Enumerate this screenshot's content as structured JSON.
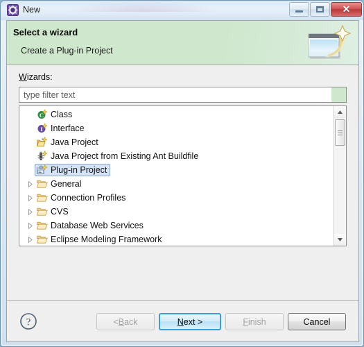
{
  "window": {
    "title": "New",
    "title_icon": "wizard-gear-icon",
    "controls": {
      "minimize": "Minimize",
      "maximize": "Maximize",
      "close": "Close",
      "close_glyph": "✕"
    }
  },
  "header": {
    "title": "Select a wizard",
    "subtitle": "Create a Plug-in Project",
    "art_icon": "new-wizard-sparkle-icon",
    "background_color": "#cfe8cd"
  },
  "body": {
    "wizards_label_prefix": "W",
    "wizards_label_rest": "izards:",
    "filter": {
      "placeholder": "type filter text",
      "value": "",
      "clear_color": "#cfe8cd"
    }
  },
  "tree": {
    "items": [
      {
        "label": "Class",
        "icon": "java-class-icon",
        "expandable": false,
        "selected": false,
        "indent": 0
      },
      {
        "label": "Interface",
        "icon": "java-interface-icon",
        "expandable": false,
        "selected": false,
        "indent": 0
      },
      {
        "label": "Java Project",
        "icon": "java-project-icon",
        "expandable": false,
        "selected": false,
        "indent": 0
      },
      {
        "label": "Java Project from Existing Ant Buildfile",
        "icon": "ant-buildfile-icon",
        "expandable": false,
        "selected": false,
        "indent": 0
      },
      {
        "label": "Plug-in Project",
        "icon": "plugin-project-icon",
        "expandable": false,
        "selected": true,
        "indent": 0
      },
      {
        "label": "General",
        "icon": "folder-icon",
        "expandable": true,
        "selected": false,
        "indent": 0
      },
      {
        "label": "Connection Profiles",
        "icon": "folder-icon",
        "expandable": true,
        "selected": false,
        "indent": 0
      },
      {
        "label": "CVS",
        "icon": "folder-icon",
        "expandable": true,
        "selected": false,
        "indent": 0
      },
      {
        "label": "Database Web Services",
        "icon": "folder-icon",
        "expandable": true,
        "selected": false,
        "indent": 0
      },
      {
        "label": "Eclipse Modeling Framework",
        "icon": "folder-icon",
        "expandable": true,
        "selected": false,
        "indent": 0
      }
    ],
    "scrollbar": {
      "up_arrow": "▲",
      "down_arrow": "▼"
    }
  },
  "footer": {
    "help_icon": "help-question-icon",
    "buttons": {
      "back": {
        "prefix": "< ",
        "accel": "B",
        "rest": "ack",
        "state": "disabled"
      },
      "next": {
        "prefix": "",
        "accel": "N",
        "rest": "ext >",
        "state": "default"
      },
      "finish": {
        "prefix": "",
        "accel": "F",
        "rest": "inish",
        "state": "disabled"
      },
      "cancel": {
        "prefix": "",
        "accel": "",
        "rest": "Cancel",
        "state": "enabled"
      }
    }
  },
  "colors": {
    "accent_blue": "#3c9ed8",
    "header_green": "#cfe8cd",
    "selection_blue": "#d4e3f5",
    "close_red": "#bb3a3a"
  }
}
